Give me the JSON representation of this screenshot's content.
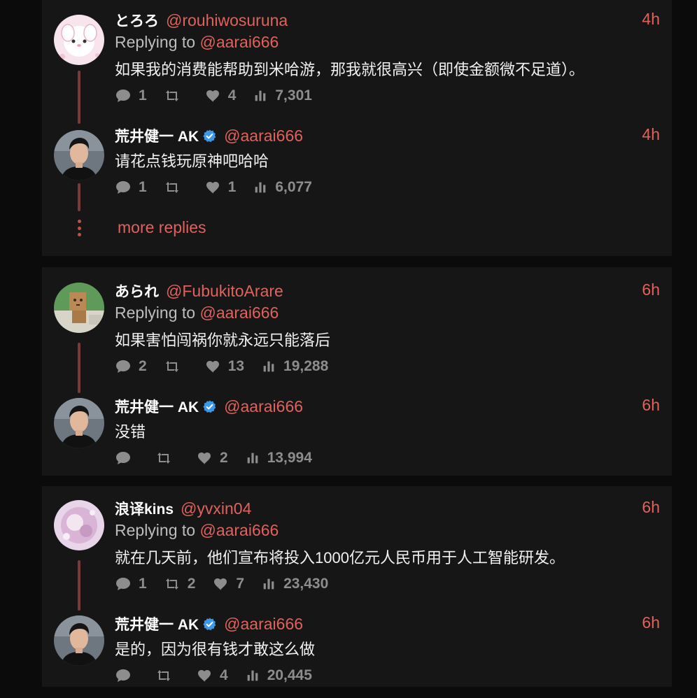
{
  "colors": {
    "accent": "#e0625d",
    "thread_line": "#7a3a37",
    "card_bg": "#161616",
    "page_bg": "#0b0b0b",
    "muted": "#8d8d8d",
    "verified": "#3c97e8"
  },
  "threads": [
    {
      "reply": {
        "name": "とろろ",
        "handle": "@rouhiwosuruna",
        "time": "4h",
        "replying_prefix": "Replying to",
        "replying_to": "@aarai666",
        "text": "如果我的消费能帮助到米哈游，那我就很高兴（即使金额微不足道）。",
        "comments": "1",
        "retweets": "",
        "likes": "4",
        "views": "7,301"
      },
      "answer": {
        "name": "荒井健一 AK",
        "handle": "@aarai666",
        "time": "4h",
        "text": "请花点钱玩原神吧哈哈",
        "comments": "1",
        "retweets": "",
        "likes": "1",
        "views": "6,077"
      },
      "more_replies": "more replies"
    },
    {
      "reply": {
        "name": "あられ",
        "handle": "@FubukitoArare",
        "time": "6h",
        "replying_prefix": "Replying to",
        "replying_to": "@aarai666",
        "text": "如果害怕闯祸你就永远只能落后",
        "comments": "2",
        "retweets": "",
        "likes": "13",
        "views": "19,288"
      },
      "answer": {
        "name": "荒井健一 AK",
        "handle": "@aarai666",
        "time": "6h",
        "text": "没错",
        "comments": "",
        "retweets": "",
        "likes": "2",
        "views": "13,994"
      }
    },
    {
      "reply": {
        "name": "浪译kins",
        "handle": "@yvxin04",
        "time": "6h",
        "replying_prefix": "Replying to",
        "replying_to": "@aarai666",
        "text": "就在几天前，他们宣布将投入1000亿元人民币用于人工智能研发。",
        "comments": "1",
        "retweets": "2",
        "likes": "7",
        "views": "23,430"
      },
      "answer": {
        "name": "荒井健一 AK",
        "handle": "@aarai666",
        "time": "6h",
        "text": "是的，因为很有钱才敢这么做",
        "comments": "",
        "retweets": "",
        "likes": "4",
        "views": "20,445"
      }
    }
  ],
  "icons": {
    "comment": "comment-icon",
    "retweet": "retweet-icon",
    "like": "heart-icon",
    "views": "views-icon",
    "verified": "verified-badge-icon",
    "more": "more-dots-icon"
  }
}
